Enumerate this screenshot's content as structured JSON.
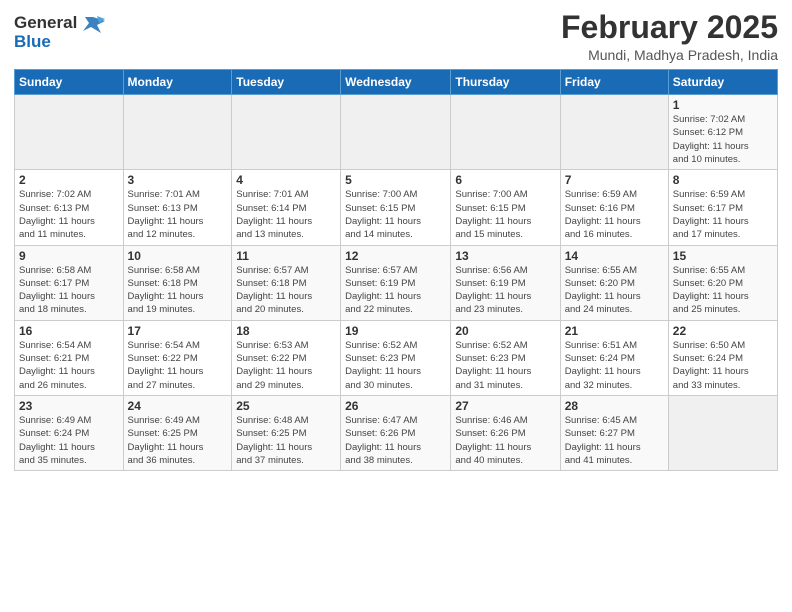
{
  "header": {
    "logo_line1": "General",
    "logo_line2": "Blue",
    "title": "February 2025",
    "subtitle": "Mundi, Madhya Pradesh, India"
  },
  "weekdays": [
    "Sunday",
    "Monday",
    "Tuesday",
    "Wednesday",
    "Thursday",
    "Friday",
    "Saturday"
  ],
  "weeks": [
    [
      {
        "day": "",
        "info": ""
      },
      {
        "day": "",
        "info": ""
      },
      {
        "day": "",
        "info": ""
      },
      {
        "day": "",
        "info": ""
      },
      {
        "day": "",
        "info": ""
      },
      {
        "day": "",
        "info": ""
      },
      {
        "day": "1",
        "info": "Sunrise: 7:02 AM\nSunset: 6:12 PM\nDaylight: 11 hours\nand 10 minutes."
      }
    ],
    [
      {
        "day": "2",
        "info": "Sunrise: 7:02 AM\nSunset: 6:13 PM\nDaylight: 11 hours\nand 11 minutes."
      },
      {
        "day": "3",
        "info": "Sunrise: 7:01 AM\nSunset: 6:13 PM\nDaylight: 11 hours\nand 12 minutes."
      },
      {
        "day": "4",
        "info": "Sunrise: 7:01 AM\nSunset: 6:14 PM\nDaylight: 11 hours\nand 13 minutes."
      },
      {
        "day": "5",
        "info": "Sunrise: 7:00 AM\nSunset: 6:15 PM\nDaylight: 11 hours\nand 14 minutes."
      },
      {
        "day": "6",
        "info": "Sunrise: 7:00 AM\nSunset: 6:15 PM\nDaylight: 11 hours\nand 15 minutes."
      },
      {
        "day": "7",
        "info": "Sunrise: 6:59 AM\nSunset: 6:16 PM\nDaylight: 11 hours\nand 16 minutes."
      },
      {
        "day": "8",
        "info": "Sunrise: 6:59 AM\nSunset: 6:17 PM\nDaylight: 11 hours\nand 17 minutes."
      }
    ],
    [
      {
        "day": "9",
        "info": "Sunrise: 6:58 AM\nSunset: 6:17 PM\nDaylight: 11 hours\nand 18 minutes."
      },
      {
        "day": "10",
        "info": "Sunrise: 6:58 AM\nSunset: 6:18 PM\nDaylight: 11 hours\nand 19 minutes."
      },
      {
        "day": "11",
        "info": "Sunrise: 6:57 AM\nSunset: 6:18 PM\nDaylight: 11 hours\nand 20 minutes."
      },
      {
        "day": "12",
        "info": "Sunrise: 6:57 AM\nSunset: 6:19 PM\nDaylight: 11 hours\nand 22 minutes."
      },
      {
        "day": "13",
        "info": "Sunrise: 6:56 AM\nSunset: 6:19 PM\nDaylight: 11 hours\nand 23 minutes."
      },
      {
        "day": "14",
        "info": "Sunrise: 6:55 AM\nSunset: 6:20 PM\nDaylight: 11 hours\nand 24 minutes."
      },
      {
        "day": "15",
        "info": "Sunrise: 6:55 AM\nSunset: 6:20 PM\nDaylight: 11 hours\nand 25 minutes."
      }
    ],
    [
      {
        "day": "16",
        "info": "Sunrise: 6:54 AM\nSunset: 6:21 PM\nDaylight: 11 hours\nand 26 minutes."
      },
      {
        "day": "17",
        "info": "Sunrise: 6:54 AM\nSunset: 6:22 PM\nDaylight: 11 hours\nand 27 minutes."
      },
      {
        "day": "18",
        "info": "Sunrise: 6:53 AM\nSunset: 6:22 PM\nDaylight: 11 hours\nand 29 minutes."
      },
      {
        "day": "19",
        "info": "Sunrise: 6:52 AM\nSunset: 6:23 PM\nDaylight: 11 hours\nand 30 minutes."
      },
      {
        "day": "20",
        "info": "Sunrise: 6:52 AM\nSunset: 6:23 PM\nDaylight: 11 hours\nand 31 minutes."
      },
      {
        "day": "21",
        "info": "Sunrise: 6:51 AM\nSunset: 6:24 PM\nDaylight: 11 hours\nand 32 minutes."
      },
      {
        "day": "22",
        "info": "Sunrise: 6:50 AM\nSunset: 6:24 PM\nDaylight: 11 hours\nand 33 minutes."
      }
    ],
    [
      {
        "day": "23",
        "info": "Sunrise: 6:49 AM\nSunset: 6:24 PM\nDaylight: 11 hours\nand 35 minutes."
      },
      {
        "day": "24",
        "info": "Sunrise: 6:49 AM\nSunset: 6:25 PM\nDaylight: 11 hours\nand 36 minutes."
      },
      {
        "day": "25",
        "info": "Sunrise: 6:48 AM\nSunset: 6:25 PM\nDaylight: 11 hours\nand 37 minutes."
      },
      {
        "day": "26",
        "info": "Sunrise: 6:47 AM\nSunset: 6:26 PM\nDaylight: 11 hours\nand 38 minutes."
      },
      {
        "day": "27",
        "info": "Sunrise: 6:46 AM\nSunset: 6:26 PM\nDaylight: 11 hours\nand 40 minutes."
      },
      {
        "day": "28",
        "info": "Sunrise: 6:45 AM\nSunset: 6:27 PM\nDaylight: 11 hours\nand 41 minutes."
      },
      {
        "day": "",
        "info": ""
      }
    ]
  ]
}
